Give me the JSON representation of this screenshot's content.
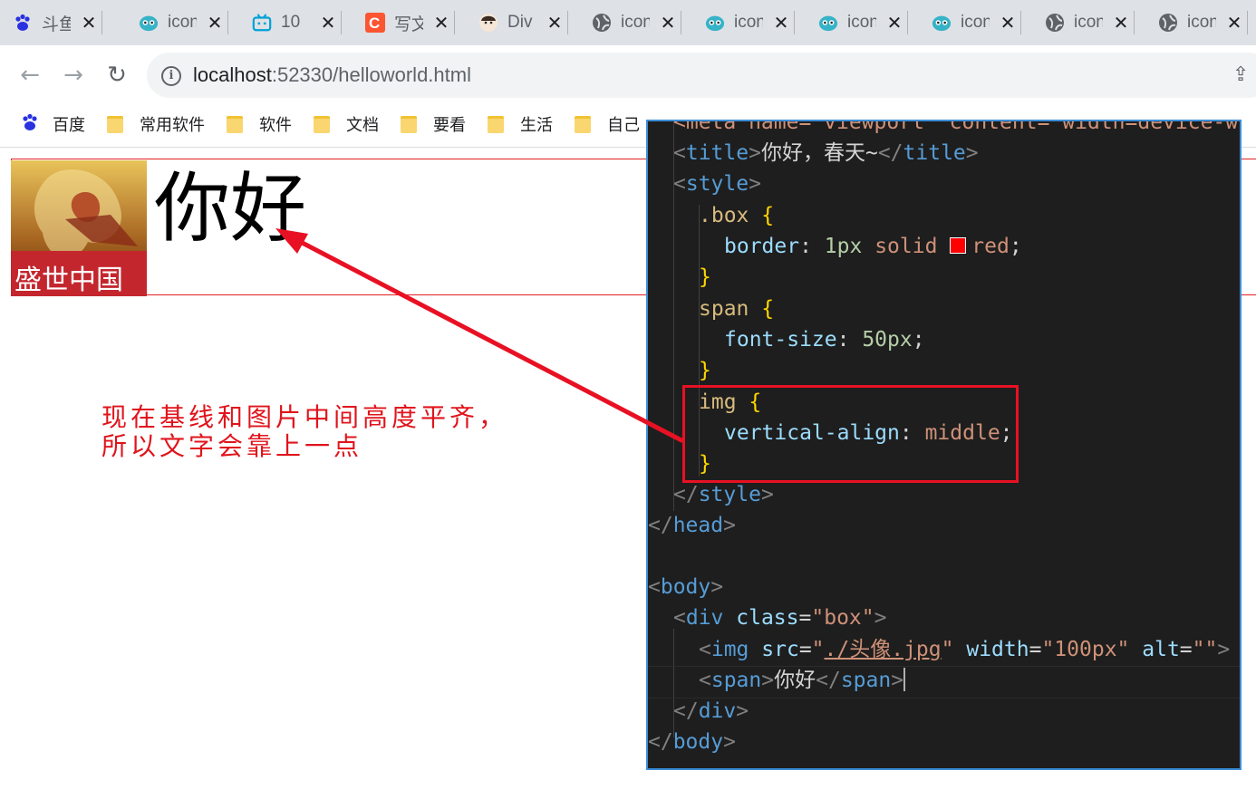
{
  "browser": {
    "tabs": [
      {
        "icon": "paw-icon",
        "title": "斗鱼"
      },
      {
        "icon": "cartoon-icon",
        "title": "icon"
      },
      {
        "icon": "bilibili-icon",
        "title": "10"
      },
      {
        "icon": "csdn-icon",
        "title": "写文"
      },
      {
        "icon": "avatar-icon",
        "title": "Div"
      },
      {
        "icon": "globe-icon",
        "title": "icon"
      },
      {
        "icon": "cartoon-icon",
        "title": "icon"
      },
      {
        "icon": "cartoon-icon",
        "title": "icon"
      },
      {
        "icon": "cartoon-icon",
        "title": "icon"
      },
      {
        "icon": "globe-icon",
        "title": "icon"
      },
      {
        "icon": "globe-icon",
        "title": "icon"
      }
    ],
    "close_glyph": "✕",
    "csdn_letter": "C",
    "address": {
      "host": "localhost",
      "rest": ":52330/helloworld.html"
    },
    "bookmarks": [
      {
        "icon": "paw-icon",
        "label": "百度"
      },
      {
        "icon": "folder-icon",
        "label": "常用软件"
      },
      {
        "icon": "folder-icon",
        "label": "软件"
      },
      {
        "icon": "folder-icon",
        "label": "文档"
      },
      {
        "icon": "folder-icon",
        "label": "要看"
      },
      {
        "icon": "folder-icon",
        "label": "生活"
      },
      {
        "icon": "folder-icon",
        "label": "自己"
      }
    ]
  },
  "page": {
    "hello_text": "你好",
    "avatar_caption": "盛世中国",
    "annotation_line1": "现在基线和图片中间高度平齐，",
    "annotation_line2": "所以文字会靠上一点"
  },
  "code": {
    "line0": "<meta name=\"viewport\" content=\"width=device-w",
    "title_open": "<title>",
    "title_text": "你好，春天~",
    "title_close": "</title>",
    "style_open": "<style>",
    "box_selector": ".box",
    "box_prop": "border",
    "box_val": "1px solid",
    "box_color": "red",
    "span_selector": "span",
    "span_prop": "font-size",
    "span_val": "50px",
    "img_selector": "img",
    "img_prop": "vertical-align",
    "img_val": "middle",
    "style_close": "</style>",
    "head_close": "</head>",
    "body_open": "<body>",
    "div_tag": "div",
    "div_attr": "class",
    "div_val": "\"box\"",
    "img_tag": "img",
    "img_src_attr": "src",
    "img_src_val": "./头像.jpg",
    "img_width_attr": "width",
    "img_width_val": "\"100px\"",
    "img_alt_attr": "alt",
    "img_alt_val": "\"\"",
    "span_tag": "span",
    "span_text": "你好",
    "div_close": "</div>",
    "body_close": "</body>"
  },
  "colors": {
    "highlight": "#e81123",
    "accent_border": "#3b8ed8"
  }
}
